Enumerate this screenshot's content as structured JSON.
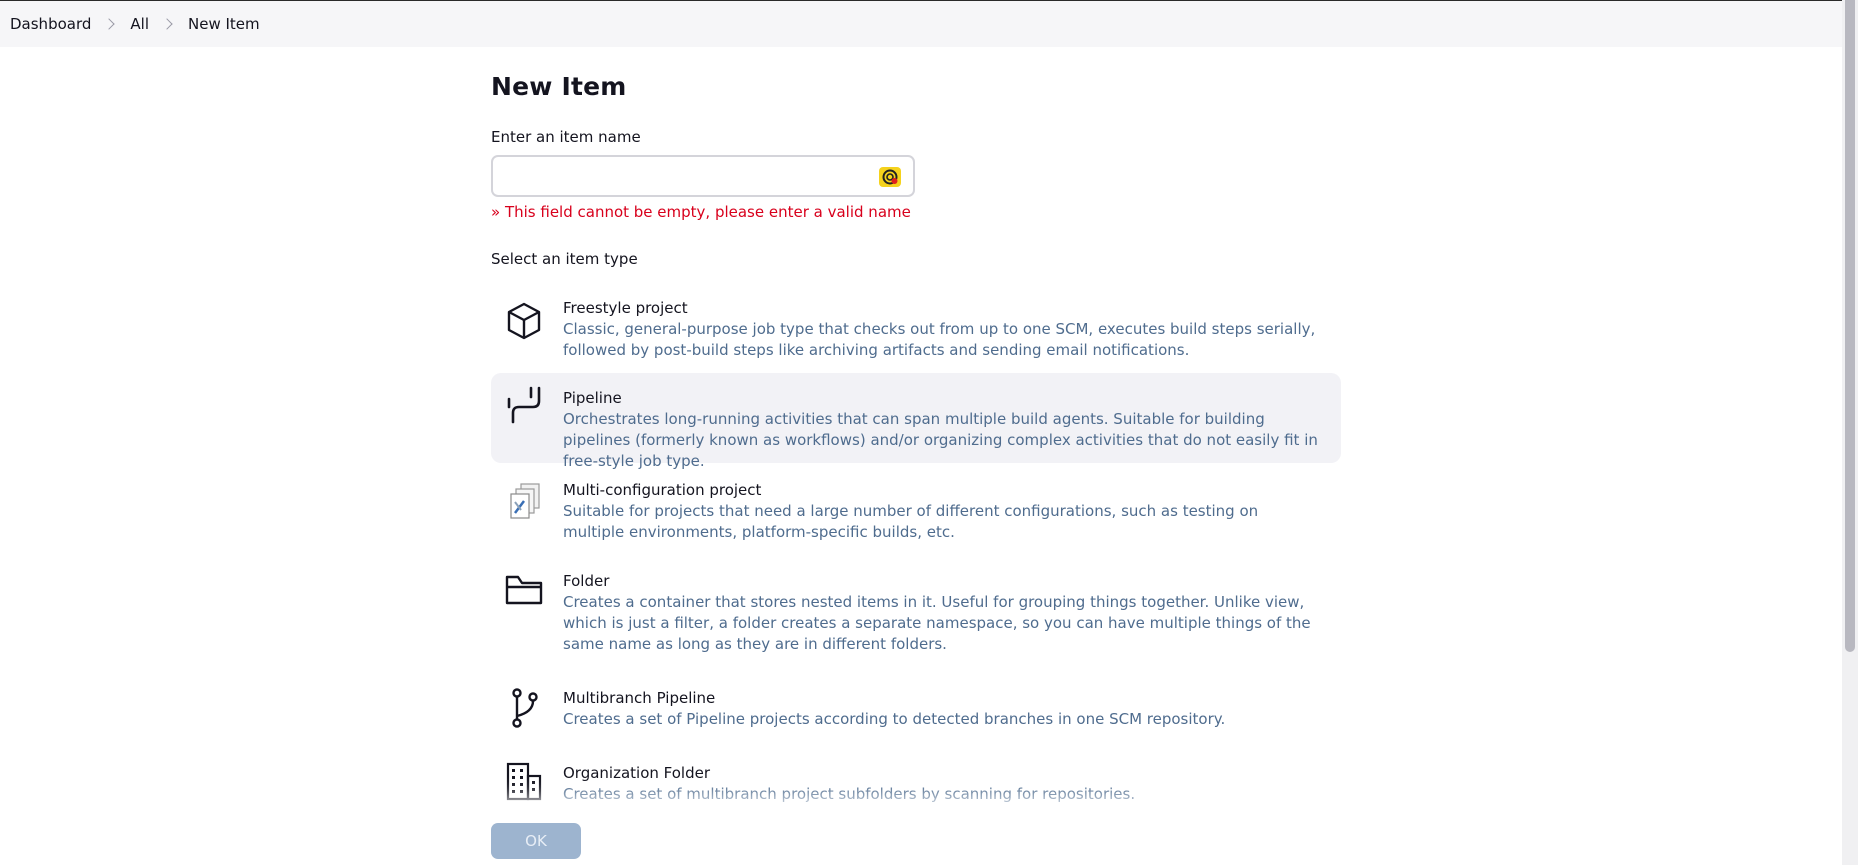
{
  "breadcrumb": {
    "items": [
      "Dashboard",
      "All",
      "New Item"
    ]
  },
  "page": {
    "title": "New Item",
    "name_label": "Enter an item name",
    "name_value": "",
    "error": "» This field cannot be empty, please enter a valid name",
    "type_label": "Select an item type"
  },
  "items": [
    {
      "title": "Freestyle project",
      "desc": "Classic, general-purpose job type that checks out from up to one SCM, executes build steps serially, followed by post-build steps like archiving artifacts and sending email notifications.",
      "icon": "cube-icon"
    },
    {
      "title": "Pipeline",
      "desc": "Orchestrates long-running activities that can span multiple build agents. Suitable for building pipelines (formerly known as workflows) and/or organizing complex activities that do not easily fit in free-style job type.",
      "icon": "pipeline-icon"
    },
    {
      "title": "Multi-configuration project",
      "desc": "Suitable for projects that need a large number of different configurations, such as testing on multiple environments, platform-specific builds, etc.",
      "icon": "multi-config-icon"
    },
    {
      "title": "Folder",
      "desc": "Creates a container that stores nested items in it. Useful for grouping things together. Unlike view, which is just a filter, a folder creates a separate namespace, so you can have multiple things of the same name as long as they are in different folders.",
      "icon": "folder-icon"
    },
    {
      "title": "Multibranch Pipeline",
      "desc": "Creates a set of Pipeline projects according to detected branches in one SCM repository.",
      "icon": "branch-icon"
    },
    {
      "title": "Organization Folder",
      "desc": "Creates a set of multibranch project subfolders by scanning for repositories.",
      "icon": "building-icon"
    }
  ],
  "ok_label": "OK"
}
